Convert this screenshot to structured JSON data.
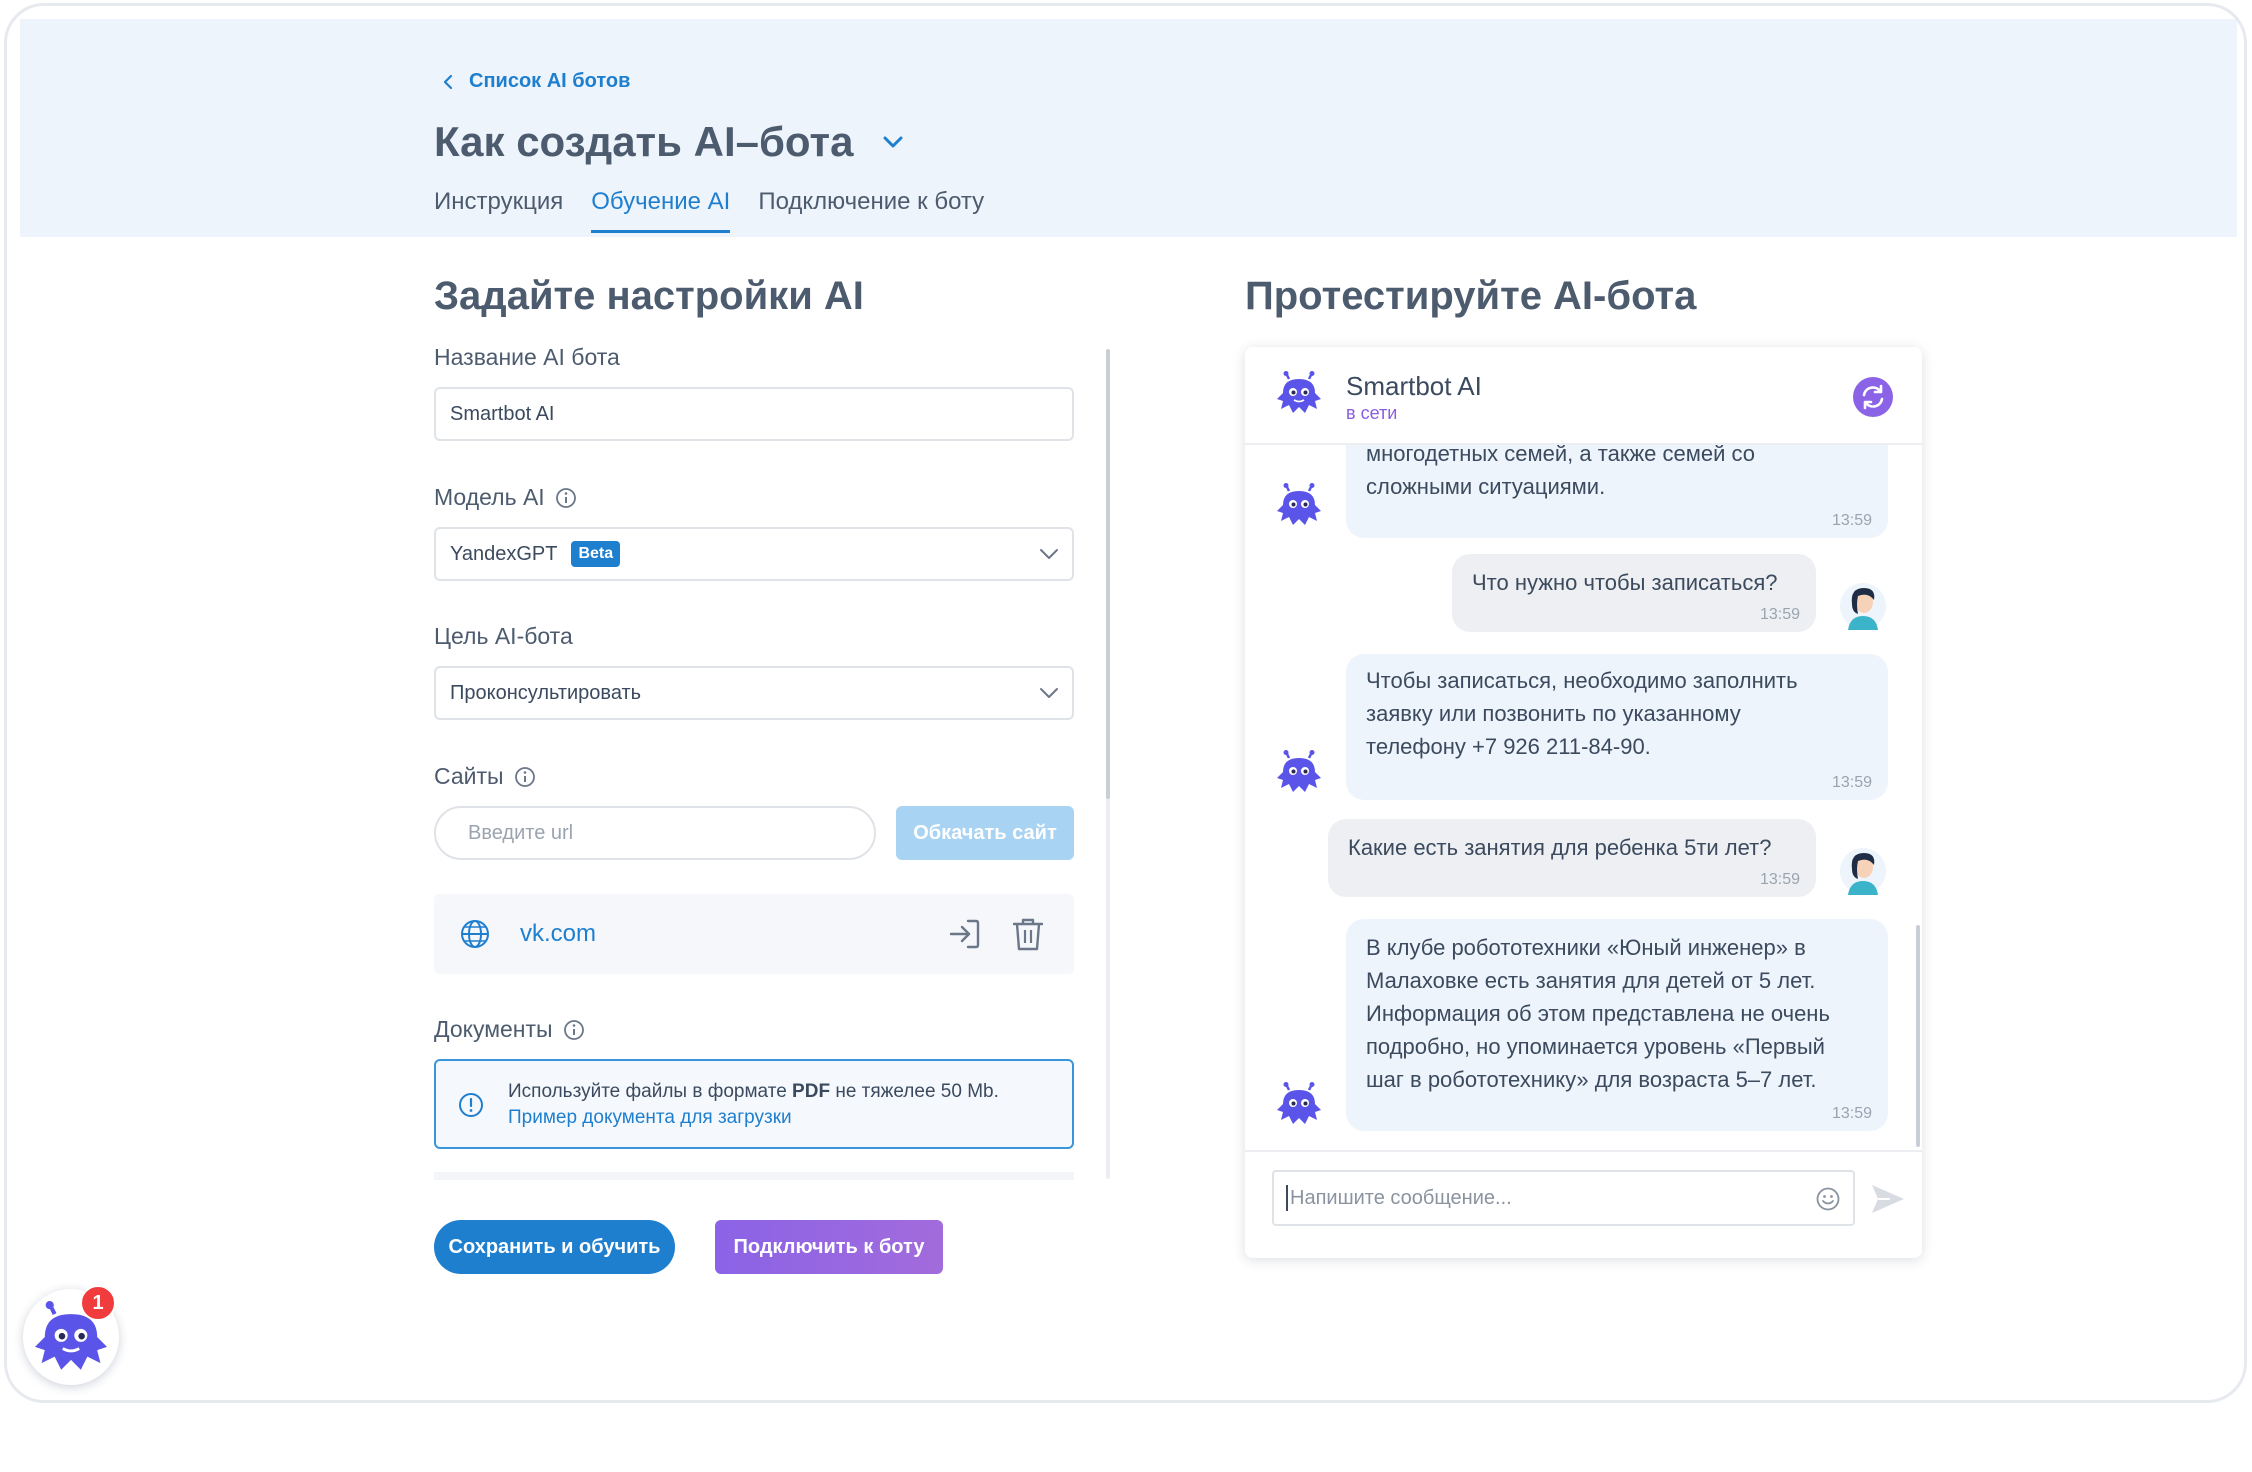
{
  "header": {
    "back_label": "Список AI ботов",
    "title": "Как создать AI–бота",
    "tabs": [
      {
        "label": "Инструкция",
        "active": false
      },
      {
        "label": "Обучение AI",
        "active": true
      },
      {
        "label": "Подключение к боту",
        "active": false
      }
    ]
  },
  "settings": {
    "section_title": "Задайте настройки AI",
    "name_label": "Название AI бота",
    "name_value": "Smartbot AI",
    "model_label": "Модель AI",
    "model_value": "YandexGPT",
    "model_badge": "Beta",
    "goal_label": "Цель AI-бота",
    "goal_value": "Проконсультировать",
    "sites_label": "Сайты",
    "url_placeholder": "Введите url",
    "crawl_button": "Обкачать сайт",
    "sites": [
      {
        "url": "vk.com"
      }
    ],
    "docs_label": "Документы",
    "docs_note_prefix": "Используйте файлы в формате",
    "docs_note_format": "PDF",
    "docs_note_suffix": "не тяжелее 50 Mb.",
    "docs_example_link": "Пример документа для загрузки",
    "save_button": "Сохранить и обучить",
    "connect_button": "Подключить к боту"
  },
  "chat": {
    "section_title": "Протестируйте AI-бота",
    "bot_name": "Smartbot AI",
    "bot_status": "в сети",
    "input_placeholder": "Напишите сообщение...",
    "messages": [
      {
        "from": "bot",
        "lines": [
          "многодетных семей, а также семей со",
          "сложными ситуациями."
        ],
        "time": "13:59"
      },
      {
        "from": "user",
        "lines": [
          "Что нужно чтобы записаться?"
        ],
        "time": "13:59"
      },
      {
        "from": "bot",
        "lines": [
          "Чтобы записаться, необходимо заполнить",
          "заявку или позвонить по указанному",
          "телефону +7 926 211-84-90."
        ],
        "time": "13:59"
      },
      {
        "from": "user",
        "lines": [
          "Какие есть занятия для ребенка 5ти лет?"
        ],
        "time": "13:59"
      },
      {
        "from": "bot",
        "lines": [
          "В клубе робототехники «Юный инженер» в",
          "Малаховке есть занятия для детей от 5 лет.",
          "Информация об этом представлена не очень",
          "подробно, но упоминается уровень «Первый",
          "шаг в робототехнику» для возраста 5–7 лет."
        ],
        "time": "13:59"
      }
    ]
  },
  "widget": {
    "badge_count": "1"
  },
  "colors": {
    "accent": "#1f7fcf",
    "purple": "#8b63e6",
    "header_bg": "#eef4fb",
    "badge_red": "#f03c3c"
  },
  "icons": [
    "chevron-left-icon",
    "chevron-down-icon",
    "info-icon",
    "globe-icon",
    "sign-in-icon",
    "trash-icon",
    "warning-circle-icon",
    "refresh-icon",
    "robot-avatar-icon",
    "user-avatar-icon",
    "emoji-icon",
    "send-icon"
  ]
}
